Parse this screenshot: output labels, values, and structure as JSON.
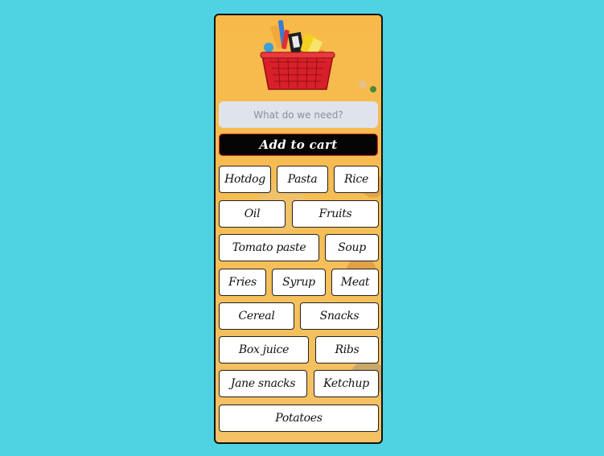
{
  "search": {
    "placeholder": "What do we need?"
  },
  "add_button": {
    "label": "Add to cart"
  },
  "items": [
    "Hotdog",
    "Pasta",
    "Rice",
    "Oil",
    "Fruits",
    "Tomato paste",
    "Soup",
    "Fries",
    "Syrup",
    "Meat",
    "Cereal",
    "Snacks",
    "Box juice",
    "Ribs",
    "Jane snacks",
    "Ketchup",
    "Potatoes"
  ],
  "colors": {
    "page_background": "#4fd3e3",
    "button_background": "#050505",
    "button_border": "#e0301e",
    "basket_red": "#d9202a",
    "chip_background": "#ffffff"
  },
  "icons": {
    "hero": "shopping-basket-icon"
  }
}
